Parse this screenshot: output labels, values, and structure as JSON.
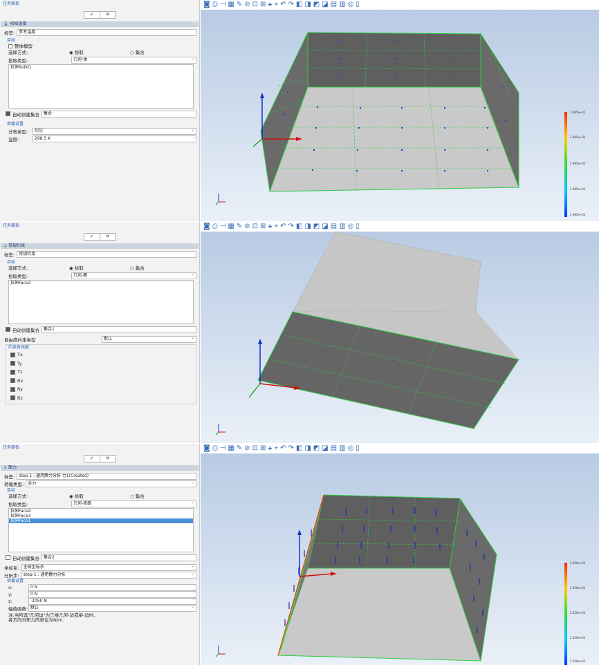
{
  "panels": [
    {
      "task_title": "任务面板",
      "ok_label": "✓",
      "cancel_label": "✕",
      "section_title": "初始温度",
      "label_caption": "标签:",
      "label_value": "参考温度",
      "target_title": "目标",
      "whole_model": "整体模型",
      "select_method_label": "选择方式:",
      "radio_pick": "拾取",
      "radio_set": "集合",
      "pick_type_label": "拾取类型:",
      "pick_type_value": "几何-体",
      "selected_items": [
        "拉伸Solid1"
      ],
      "auto_set_label": "自动创建集合",
      "auto_set_value": "集合",
      "load_settings_title": "荷载设置",
      "dist_type_label": "分布类型:",
      "dist_type_value": "均匀",
      "temp_label": "温度:",
      "temp_value": "298.5 K",
      "colorbar_labels": [
        "2.985e+02",
        "2.985e+02",
        "2.985e+02",
        "2.985e+02",
        "2.985e+02"
      ]
    },
    {
      "task_title": "任务面板",
      "ok_label": "✓",
      "cancel_label": "✕",
      "section_title": "常规约束",
      "label_caption": "标签:",
      "label_value": "常规约束",
      "target_title": "目标",
      "select_method_label": "选择方式:",
      "radio_pick": "拾取",
      "radio_set": "集合",
      "pick_type_label": "拾取类型:",
      "pick_type_value": "几何-面",
      "selected_items": [
        "拉伸Face2"
      ],
      "auto_set_label": "自动创建集合",
      "auto_set_value": "集合1",
      "dof_constraint_label": "自由度约束类型",
      "dof_constraint_value": "默认",
      "dof_group_title": "约束自由度",
      "dofs": [
        "Tx",
        "Ty",
        "Tz",
        "Rx",
        "Ry",
        "Rz"
      ]
    },
    {
      "task_title": "任务面板",
      "ok_label": "✓",
      "cancel_label": "✕",
      "section_title": "面力",
      "label_caption": "标签:",
      "label_value": "step-1 : 通用静力分析 力1(Created)",
      "load_type_label": "荷载类型:",
      "load_type_value": "合力",
      "target_title": "目标",
      "select_method_label": "选择方式:",
      "radio_pick": "拾取",
      "radio_set": "集合",
      "pick_type_label": "拾取类型:",
      "pick_type_value": "几何-表面",
      "selected_items": [
        "拉伸Face4",
        "拉伸Face3",
        "拉伸Face1"
      ],
      "auto_set_label": "自动创建集合",
      "auto_set_value": "集合2",
      "csys_label": "坐标系:",
      "csys_value": "全局坐标系",
      "step_label": "分析步:",
      "step_value": "step-1 : 通用静力分析",
      "load_settings_title": "荷载设置",
      "x_label": "x:",
      "x_value": "0 N",
      "y_label": "y:",
      "y_value": "0 N",
      "z_label": "z:",
      "z_value": "-2050 N",
      "amp_label": "幅值函数:",
      "amp_value": "默认",
      "note": "注:当所选\"几何边\"为三维几何-边或梁-边时,\n各方向分布力的单位为N/m.",
      "colorbar_labels": [
        "2.050e+02",
        "2.050e+02",
        "2.050e+02",
        "2.050e+02",
        "2.050e+02"
      ]
    }
  ],
  "toolbar_icons": [
    "view-cube-icon",
    "print-icon",
    "measure-icon",
    "grid-icon",
    "paint-icon",
    "filter-icon",
    "zoom-fit-icon",
    "zoom-box-icon",
    "section-icon",
    "select-icon",
    "undo-icon",
    "redo-icon",
    "render1-icon",
    "render2-icon",
    "render3-icon",
    "render4-icon",
    "render5-icon",
    "render6-icon",
    "render7-icon",
    "render8-icon",
    "box-icon"
  ],
  "colors": {
    "accent": "#1c5fb5",
    "section_bg": "#cbd3df",
    "edge_green": "#2ecc40"
  }
}
